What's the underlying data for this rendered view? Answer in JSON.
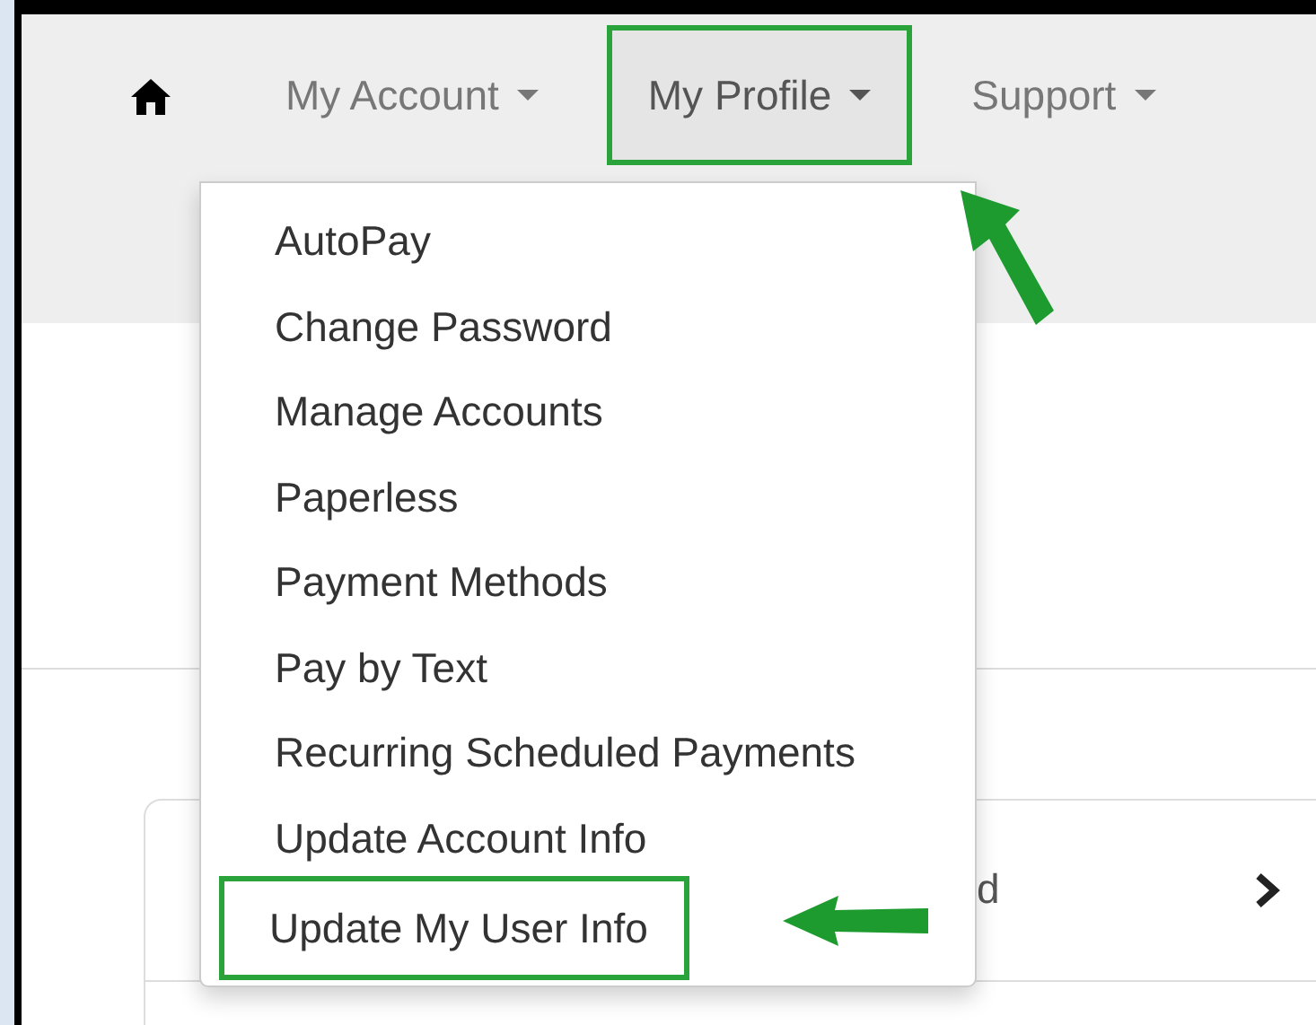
{
  "nav": {
    "items": [
      {
        "kind": "home"
      },
      {
        "kind": "menu",
        "label": "My Account",
        "expanded": false,
        "highlighted": false
      },
      {
        "kind": "menu",
        "label": "My Profile",
        "expanded": true,
        "highlighted": true
      },
      {
        "kind": "menu",
        "label": "Support",
        "expanded": false,
        "highlighted": false
      }
    ]
  },
  "dropdown": {
    "items": [
      {
        "label": "AutoPay",
        "highlighted": false
      },
      {
        "label": "Change Password",
        "highlighted": false
      },
      {
        "label": "Manage Accounts",
        "highlighted": false
      },
      {
        "label": "Paperless",
        "highlighted": false
      },
      {
        "label": "Payment Methods",
        "highlighted": false
      },
      {
        "label": "Pay by Text",
        "highlighted": false
      },
      {
        "label": "Recurring Scheduled Payments",
        "highlighted": false
      },
      {
        "label": "Update Account Info",
        "highlighted": false
      },
      {
        "label": "Update My User Info",
        "highlighted": true
      }
    ]
  },
  "background_card": {
    "text_fragment": "d"
  }
}
